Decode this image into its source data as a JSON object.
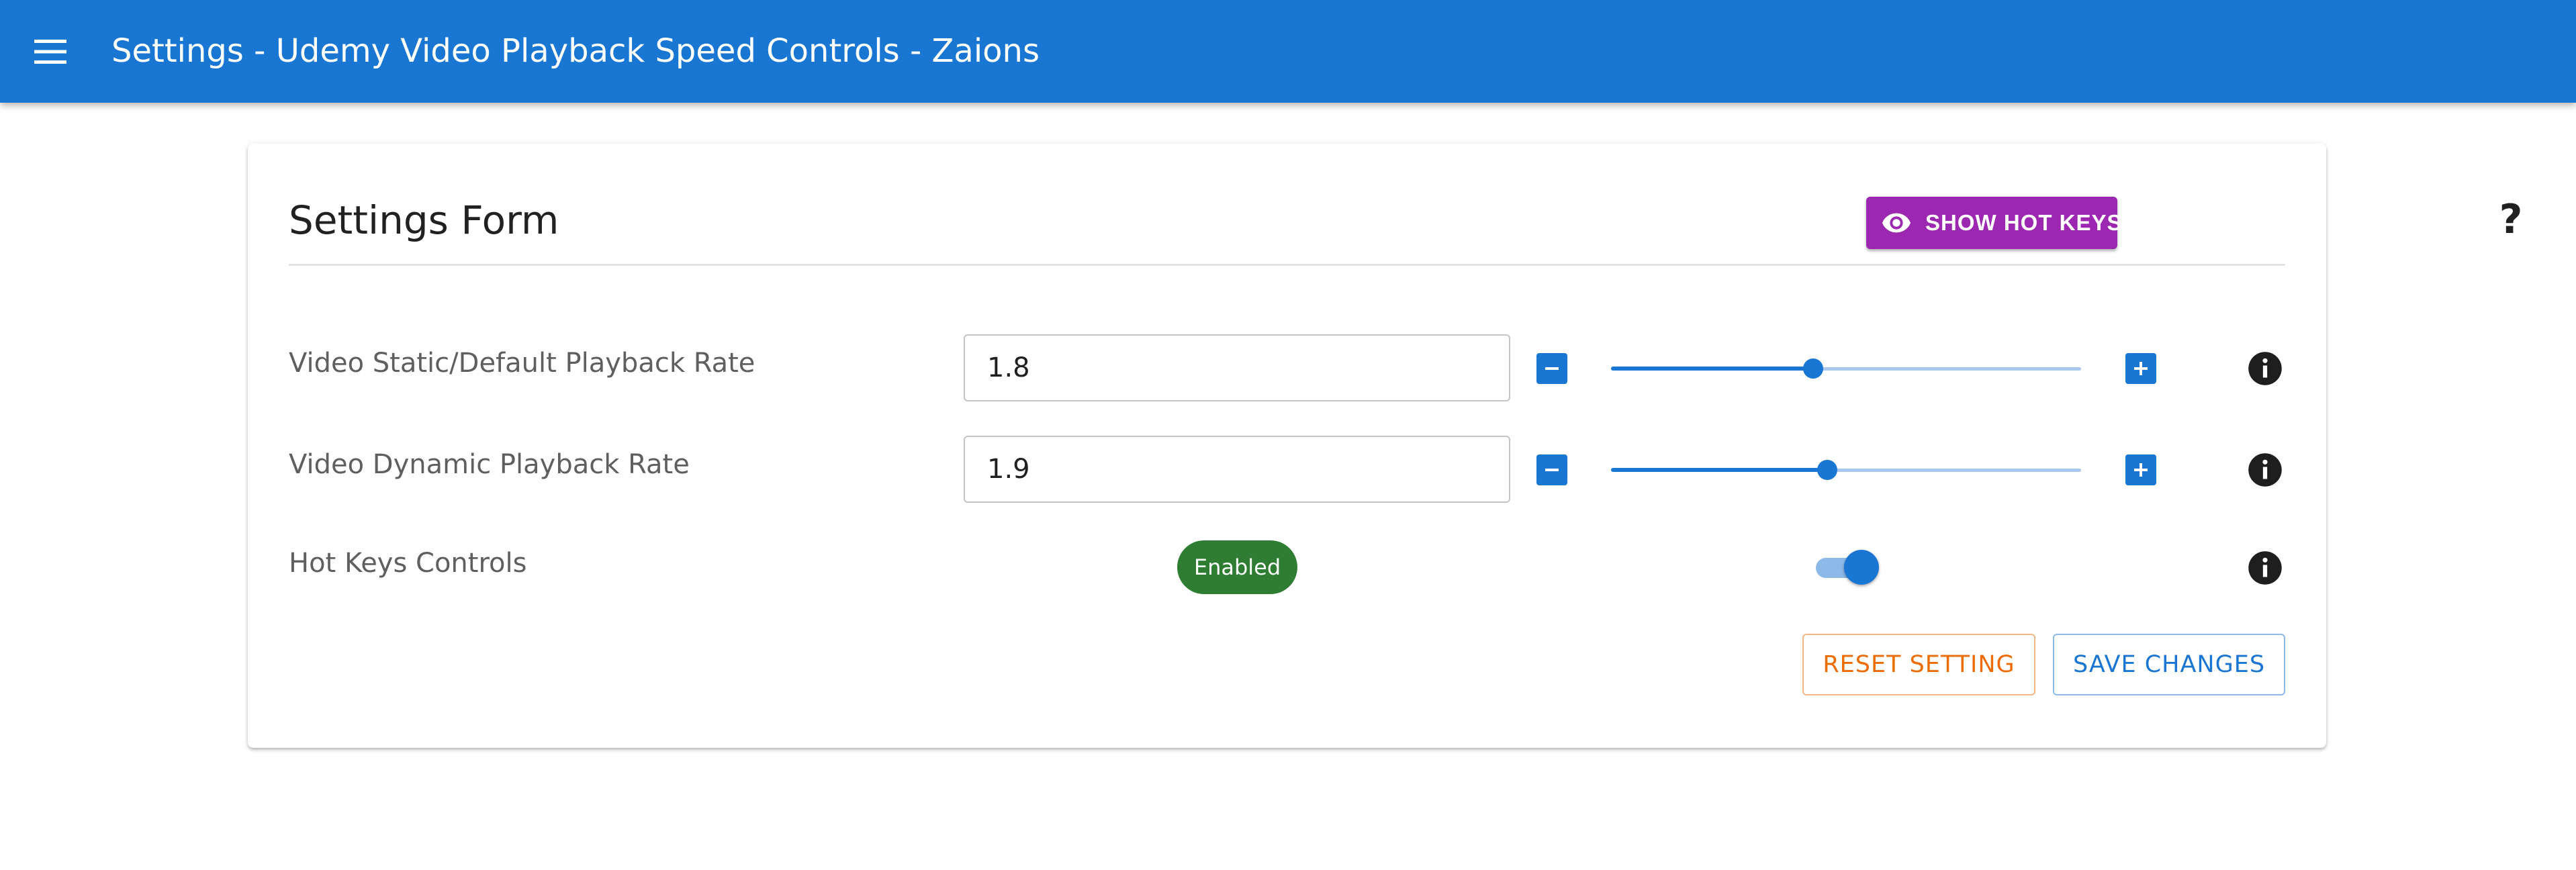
{
  "appbar": {
    "title": "Settings - Udemy Video Playback Speed Controls - Zaions",
    "menu_icon": "hamburger-menu-icon"
  },
  "form": {
    "title": "Settings Form",
    "show_hotkeys_label": "SHOW HOT KEYS",
    "show_hotkeys_icon": "eye-icon",
    "help_label": "?",
    "rows": {
      "static_rate": {
        "label": "Video Static/Default Playback Rate",
        "value": "1.8",
        "slider_fraction": 0.43
      },
      "dynamic_rate": {
        "label": "Video Dynamic Playback Rate",
        "value": "1.9",
        "slider_fraction": 0.46
      },
      "hotkeys": {
        "label": "Hot Keys Controls",
        "status": "Enabled",
        "toggle_on": true
      }
    },
    "reset_label": "RESET SETTING",
    "save_label": "SAVE CHANGES"
  },
  "colors": {
    "primary": "#1976d2",
    "secondary": "#9c27b0",
    "success": "#2e7d32",
    "warning": "#ed6c02"
  }
}
